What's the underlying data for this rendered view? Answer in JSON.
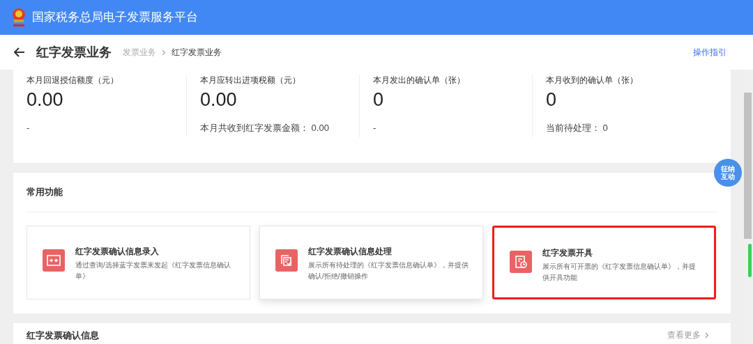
{
  "header": {
    "title": "国家税务总局电子发票服务平台"
  },
  "page": {
    "title": "红字发票业务",
    "breadcrumb": [
      {
        "label": "发票业务",
        "selected": false
      },
      {
        "label": "红字发票业务",
        "selected": true
      }
    ],
    "guide_link": "操作指引"
  },
  "stats": [
    {
      "label": "本月回退授信额度（元）",
      "value": "0.00",
      "note": "-"
    },
    {
      "label": "本月应转出进项税额（元）",
      "value": "0.00",
      "note": "本月共收到红字发票金额： 0.00"
    },
    {
      "label": "本月发出的确认单（张）",
      "value": "0",
      "note": "-"
    },
    {
      "label": "本月收到的确认单（张）",
      "value": "0",
      "note": "当前待处理： 0"
    }
  ],
  "functions": {
    "title": "常用功能",
    "cards": [
      {
        "kind": "entry",
        "title": "红字发票确认信息录入",
        "description": "通过查询/选择蓝字发票来发起《红字发票信息确认单》",
        "hovered": false,
        "highlighted": false
      },
      {
        "kind": "process",
        "title": "红字发票确认信息处理",
        "description": "展示所有待处理的《红字发票信息确认单》，并提供确认/拒绝/撤销操作",
        "hovered": true,
        "highlighted": false
      },
      {
        "kind": "issue",
        "title": "红字发票开具",
        "description": "展示所有可开票的《红字发票信息确认单》，并提供开具功能",
        "hovered": false,
        "highlighted": true
      }
    ]
  },
  "confirm_section": {
    "title": "红字发票确认信息",
    "more_link": "查看更多"
  },
  "assistant": {
    "chars": [
      "征",
      "纳",
      "互",
      "动"
    ]
  }
}
